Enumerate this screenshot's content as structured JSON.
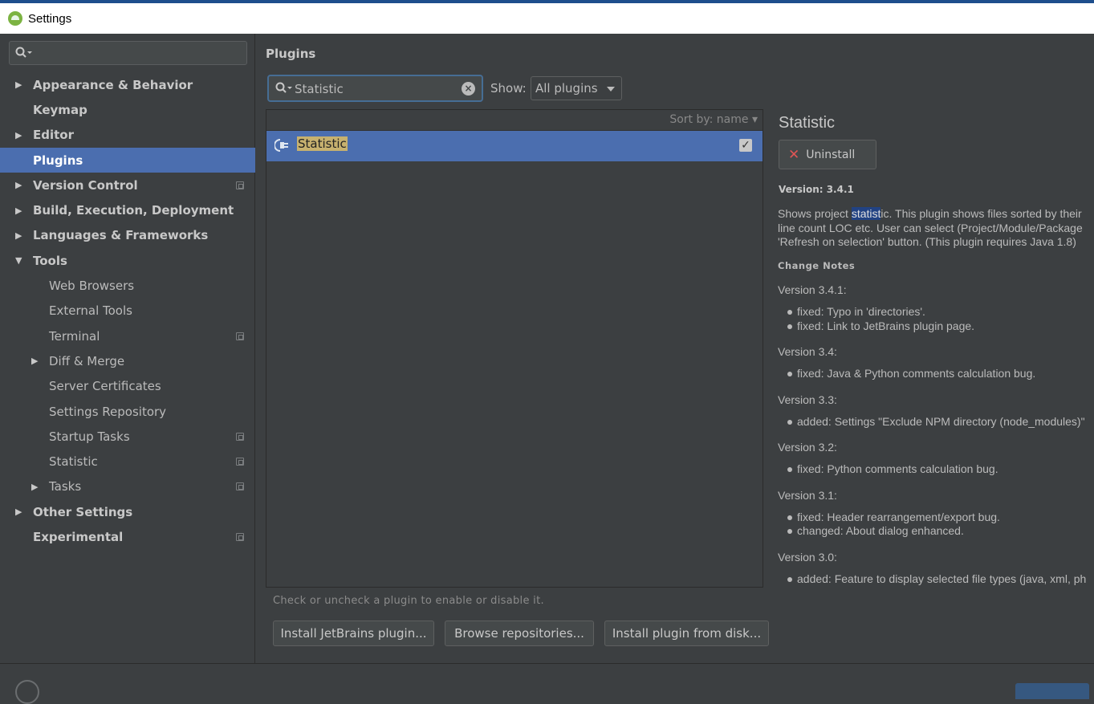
{
  "window": {
    "title": "Settings"
  },
  "sidebar": {
    "search": {
      "value": ""
    },
    "items": [
      {
        "label": "Appearance & Behavior",
        "level": 0,
        "arrow": "right",
        "bold": true,
        "selected": false,
        "project": false
      },
      {
        "label": "Keymap",
        "level": 0,
        "arrow": "none",
        "bold": true,
        "selected": false,
        "project": false
      },
      {
        "label": "Editor",
        "level": 0,
        "arrow": "right",
        "bold": true,
        "selected": false,
        "project": false
      },
      {
        "label": "Plugins",
        "level": 0,
        "arrow": "none",
        "bold": true,
        "selected": true,
        "project": false
      },
      {
        "label": "Version Control",
        "level": 0,
        "arrow": "right",
        "bold": true,
        "selected": false,
        "project": true
      },
      {
        "label": "Build, Execution, Deployment",
        "level": 0,
        "arrow": "right",
        "bold": true,
        "selected": false,
        "project": false
      },
      {
        "label": "Languages & Frameworks",
        "level": 0,
        "arrow": "right",
        "bold": true,
        "selected": false,
        "project": false
      },
      {
        "label": "Tools",
        "level": 0,
        "arrow": "down",
        "bold": true,
        "selected": false,
        "project": false
      },
      {
        "label": "Web Browsers",
        "level": 1,
        "arrow": "none",
        "bold": false,
        "selected": false,
        "project": false
      },
      {
        "label": "External Tools",
        "level": 1,
        "arrow": "none",
        "bold": false,
        "selected": false,
        "project": false
      },
      {
        "label": "Terminal",
        "level": 1,
        "arrow": "none",
        "bold": false,
        "selected": false,
        "project": true
      },
      {
        "label": "Diff & Merge",
        "level": 1,
        "arrow": "right",
        "bold": false,
        "selected": false,
        "project": false
      },
      {
        "label": "Server Certificates",
        "level": 1,
        "arrow": "none",
        "bold": false,
        "selected": false,
        "project": false
      },
      {
        "label": "Settings Repository",
        "level": 1,
        "arrow": "none",
        "bold": false,
        "selected": false,
        "project": false
      },
      {
        "label": "Startup Tasks",
        "level": 1,
        "arrow": "none",
        "bold": false,
        "selected": false,
        "project": true
      },
      {
        "label": "Statistic",
        "level": 1,
        "arrow": "none",
        "bold": false,
        "selected": false,
        "project": true
      },
      {
        "label": "Tasks",
        "level": 1,
        "arrow": "right",
        "bold": false,
        "selected": false,
        "project": true
      },
      {
        "label": "Other Settings",
        "level": 0,
        "arrow": "right",
        "bold": true,
        "selected": false,
        "project": false
      },
      {
        "label": "Experimental",
        "level": 0,
        "arrow": "none",
        "bold": true,
        "selected": false,
        "project": true
      }
    ]
  },
  "main": {
    "title": "Plugins",
    "search": {
      "value": "Statistic"
    },
    "show_label": "Show:",
    "show_value": "All plugins",
    "sort_label": "Sort by: name",
    "plugins": [
      {
        "name": "Statistic",
        "enabled": true
      }
    ],
    "detail": {
      "name": "Statistic",
      "uninstall_label": "Uninstall",
      "version": "Version: 3.4.1",
      "desc_line1_pre": "Shows project ",
      "desc_line1_hl": "statist",
      "desc_line1_post": "ic. This plugin shows files sorted by their",
      "desc_line2": "line count LOC etc. User can select (Project/Module/Package",
      "desc_line3": "'Refresh on selection' button. (This plugin requires Java 1.8)",
      "change_notes_title": "Change Notes",
      "notes": [
        {
          "version": "Version 3.4.1:",
          "items": [
            "fixed: Typo in 'directories'.",
            "fixed: Link to JetBrains plugin page."
          ]
        },
        {
          "version": "Version 3.4:",
          "items": [
            "fixed: Java & Python comments calculation bug."
          ]
        },
        {
          "version": "Version 3.3:",
          "items": [
            "added: Settings \"Exclude NPM directory (node_modules)\""
          ]
        },
        {
          "version": "Version 3.2:",
          "items": [
            "fixed: Python comments calculation bug."
          ]
        },
        {
          "version": "Version 3.1:",
          "items": [
            "fixed: Header rearrangement/export bug.",
            "changed: About dialog enhanced."
          ]
        },
        {
          "version": "Version 3.0:",
          "items": [
            "added: Feature to display selected file types (java, xml, ph"
          ]
        }
      ]
    },
    "hint": "Check or uncheck a plugin to enable or disable it.",
    "buttons": {
      "install_jetbrains": "Install JetBrains plugin...",
      "browse": "Browse repositories...",
      "install_disk": "Install plugin from disk..."
    }
  },
  "colors": {
    "accent": "#4b6eaf",
    "match_highlight": "#c7b16f",
    "uninstall_x": "#e05555"
  }
}
